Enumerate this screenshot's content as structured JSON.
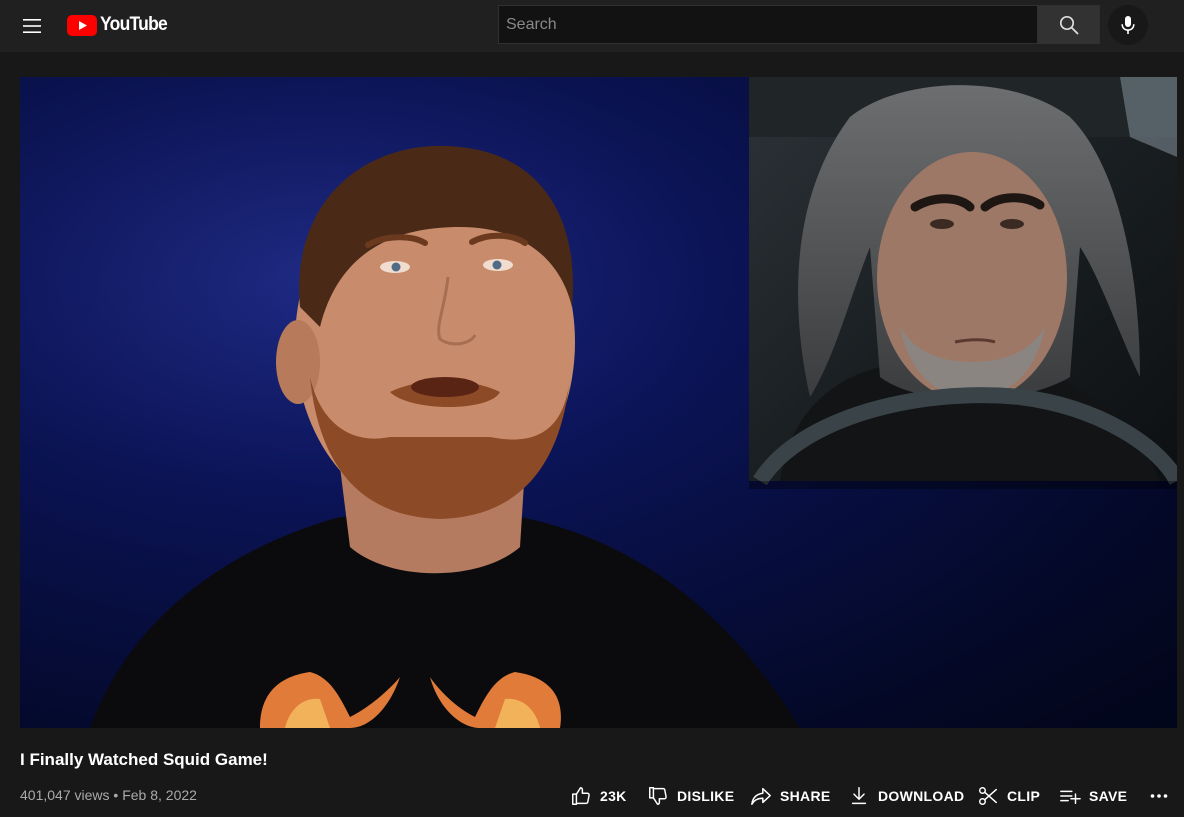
{
  "masthead": {
    "menu_icon": "hamburger-menu-icon",
    "logo_text": "YouTube",
    "search": {
      "placeholder": "Search",
      "value": ""
    },
    "search_icon": "search-icon",
    "mic_icon": "microphone-icon"
  },
  "video": {
    "title": "I Finally Watched Squid Game!",
    "views": "401,047 views",
    "separator": "•",
    "date": "Feb 8, 2022"
  },
  "actions": {
    "like_count": "23K",
    "dislike_label": "DISLIKE",
    "share_label": "SHARE",
    "download_label": "DOWNLOAD",
    "clip_label": "CLIP",
    "save_label": "SAVE",
    "more_icon": "more-horizontal-icon"
  },
  "colors": {
    "background": "#181818",
    "masthead": "#202020",
    "brand_red": "#FF0000",
    "text_primary": "#FFFFFF",
    "text_secondary": "#AAAAAA"
  }
}
